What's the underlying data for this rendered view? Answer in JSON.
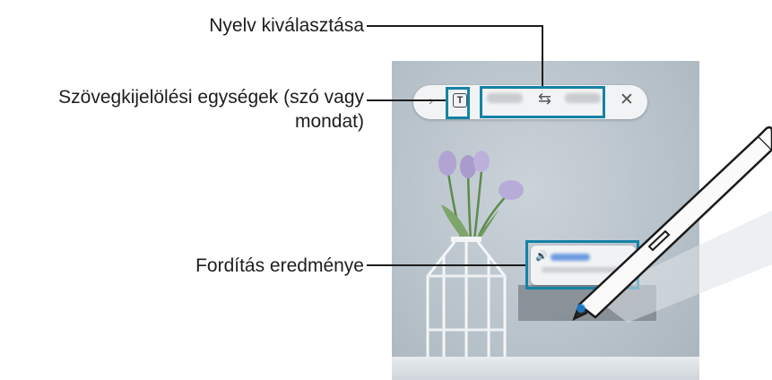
{
  "callouts": {
    "language_selection": "Nyelv kiválasztása",
    "text_units_line1": "Szövegkijelölési egységek (szó vagy",
    "text_units_line2": "mondat)",
    "translation_result": "Fordítás eredménye"
  },
  "toolbar": {
    "expand_glyph": "›",
    "text_unit_glyph": "T",
    "swap_glyph": "⇆",
    "close_glyph": "✕"
  },
  "result": {
    "speaker_glyph": "🔊"
  },
  "colors": {
    "callout_stroke": "#1582a6",
    "leader_line": "#1d1d1d"
  },
  "icons": [
    "chevron-right-icon",
    "text-select-icon",
    "swap-icon",
    "close-icon",
    "speaker-icon",
    "s-pen-icon"
  ]
}
